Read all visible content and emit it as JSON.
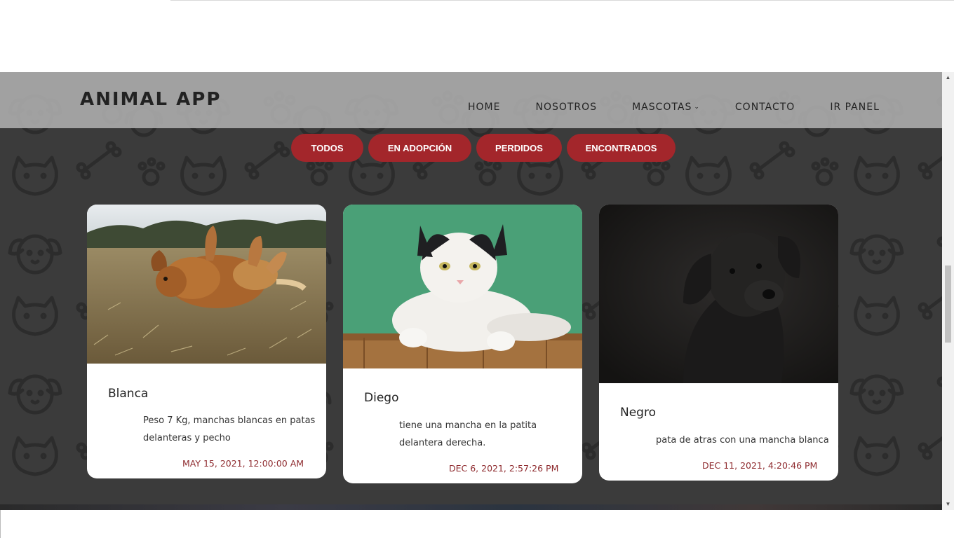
{
  "header": {
    "brand": "ANIMAL APP",
    "nav": [
      {
        "label": "HOME"
      },
      {
        "label": "NOSOTROS"
      },
      {
        "label": "MASCOTAS"
      },
      {
        "label": "CONTACTO"
      },
      {
        "label": "IR PANEL"
      }
    ],
    "mascotas_chevron": "chevron-down-icon"
  },
  "filters": [
    {
      "label": "TODOS"
    },
    {
      "label": "EN ADOPCIÓN"
    },
    {
      "label": "PERDIDOS"
    },
    {
      "label": "ENCONTRADOS"
    }
  ],
  "cards": [
    {
      "name": "Blanca",
      "description_lines": [
        "Peso 7 Kg, manchas blancas en patas",
        "delanteras y pecho"
      ],
      "date": "MAY 15, 2021, 12:00:00 AM"
    },
    {
      "name": "Diego",
      "description_lines": [
        "tiene una mancha en la patita",
        "delantera derecha."
      ],
      "date": "DEC 6, 2021, 2:57:26 PM"
    },
    {
      "name": "Negro",
      "description_lines": [
        "pata de atras con una mancha blanca"
      ],
      "date": "DEC 11, 2021, 4:20:46 PM"
    }
  ],
  "colors": {
    "accent": "#a3262b",
    "date": "#8e2a2e",
    "background": "#3b3b3b"
  }
}
